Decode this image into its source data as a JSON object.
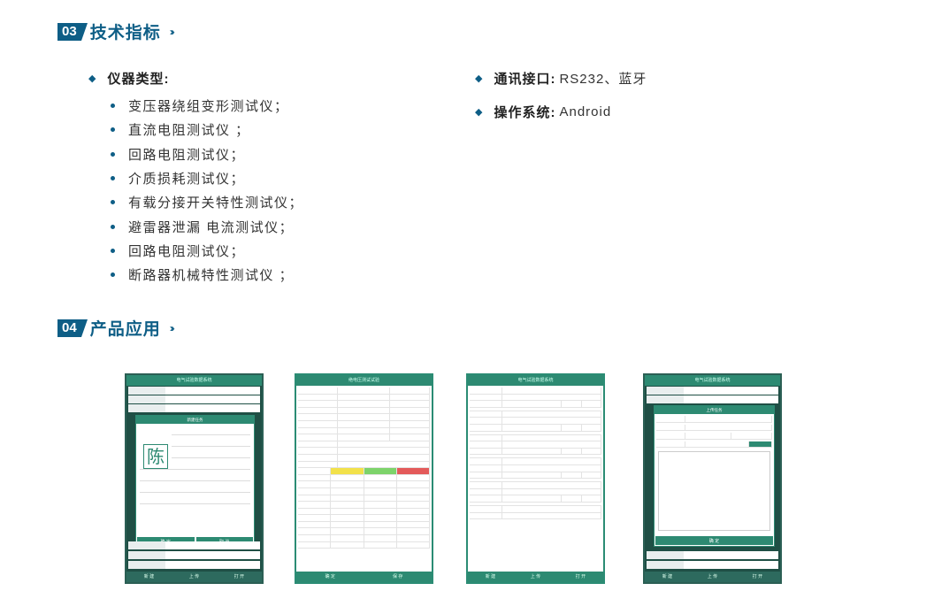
{
  "section3": {
    "badge": "03",
    "title": "技术指标",
    "chevrons": "›››"
  },
  "specs": {
    "instrument_label": "仪器类型:",
    "instruments": [
      "变压器绕组变形测试仪；",
      "直流电阻测试仪 ；",
      "回路电阻测试仪；",
      "介质损耗测试仪；",
      "有载分接开关特性测试仪；",
      "避雷器泄漏 电流测试仪；",
      "回路电阻测试仪；",
      "断路器机械特性测试仪 ；"
    ],
    "interface_label": "通讯接口:",
    "interface_value": "RS232、蓝牙",
    "os_label": "操作系统:",
    "os_value": "Android"
  },
  "section4": {
    "badge": "04",
    "title": "产品应用",
    "chevrons": "›››"
  },
  "screens": {
    "s1": {
      "title": "电气试验数据系统",
      "dialog_title": "新建任务",
      "char": "陈",
      "ok": "确 定",
      "cancel": "取 消",
      "bottom": [
        "新 建",
        "上 传",
        "打 开"
      ]
    },
    "s2": {
      "title": "绝电压测试试验",
      "ok": "确 定",
      "cancel": "保 存"
    },
    "s3": {
      "title": "电气试验数据系统",
      "bottom": [
        "新 建",
        "上 传",
        "打 开"
      ]
    },
    "s4": {
      "title": "电气试验数据系统",
      "dialog_title": "上传任务",
      "ok": "确 定",
      "bottom": [
        "新 建",
        "上 传",
        "打 开"
      ]
    }
  }
}
